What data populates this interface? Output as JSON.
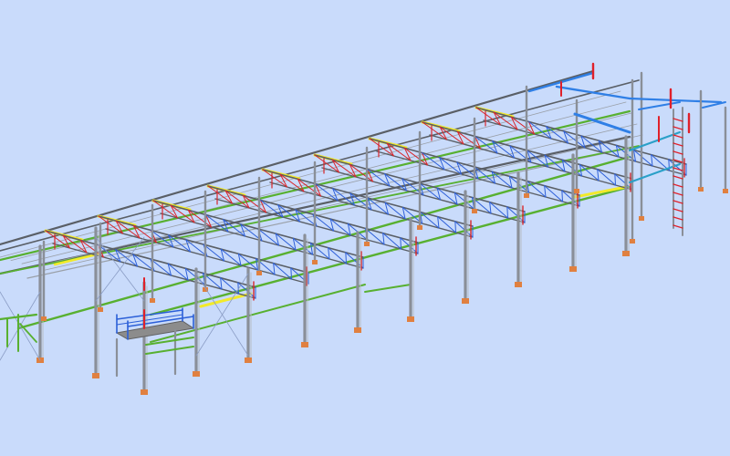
{
  "colors": {
    "background": "#c9dbfb",
    "column": "#8a8f98",
    "rafter": "#5a5f66",
    "purlin": "#9aa0a8",
    "truss_chord_top": "#f2ea2a",
    "truss_web_red": "#d8262a",
    "truss_web_blue": "#2d5fd8",
    "girt_green": "#58b030",
    "brace_blue": "#2f7fe6",
    "brace_cyan": "#2aa0c8",
    "bracing_thin": "#8a9cc4",
    "base_plate": "#e08040",
    "platform_deck": "#8c8c8c",
    "platform_rail": "#2b5fd8",
    "highlight_red": "#e0202a"
  },
  "icons": []
}
